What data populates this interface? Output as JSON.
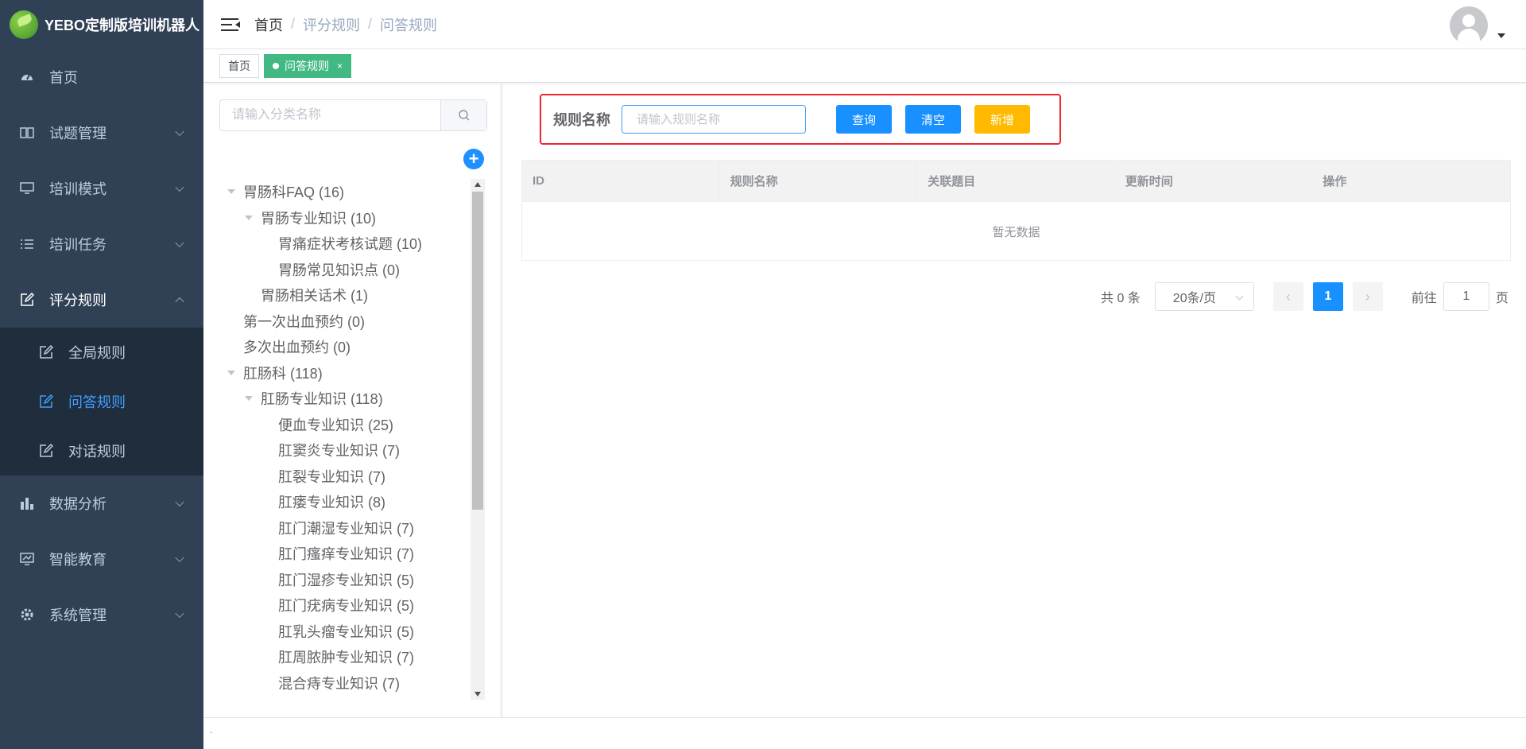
{
  "brand": {
    "title": "YEBO定制版培训机器人"
  },
  "sidebar": {
    "items": [
      {
        "label": "首页",
        "icon": "dashboard-icon",
        "has_children": false
      },
      {
        "label": "试题管理",
        "icon": "book-icon",
        "has_children": true
      },
      {
        "label": "培训模式",
        "icon": "monitor-icon",
        "has_children": true
      },
      {
        "label": "培训任务",
        "icon": "list-icon",
        "has_children": true
      },
      {
        "label": "评分规则",
        "icon": "edit-icon",
        "has_children": true,
        "open": true,
        "children": [
          {
            "label": "全局规则",
            "icon": "edit-icon",
            "active": false
          },
          {
            "label": "问答规则",
            "icon": "edit-icon",
            "active": true
          },
          {
            "label": "对话规则",
            "icon": "edit-icon",
            "active": false
          }
        ]
      },
      {
        "label": "数据分析",
        "icon": "chart-icon",
        "has_children": true
      },
      {
        "label": "智能教育",
        "icon": "education-icon",
        "has_children": true
      },
      {
        "label": "系统管理",
        "icon": "gear-icon",
        "has_children": true
      }
    ]
  },
  "header": {
    "breadcrumb": [
      "首页",
      "评分规则",
      "问答规则"
    ],
    "separator": "/"
  },
  "tags": [
    {
      "label": "首页",
      "active": false
    },
    {
      "label": "问答规则",
      "active": true,
      "close": "×"
    }
  ],
  "tree_panel": {
    "search_placeholder": "请输入分类名称",
    "add_symbol": "+",
    "nodes": [
      {
        "label": "胃肠科FAQ (16)",
        "level": 0,
        "expanded": true
      },
      {
        "label": "胃肠专业知识 (10)",
        "level": 1,
        "expanded": true
      },
      {
        "label": "胃痛症状考核试题 (10)",
        "level": 2
      },
      {
        "label": "胃肠常见知识点 (0)",
        "level": 2
      },
      {
        "label": "胃肠相关话术 (1)",
        "level": 1
      },
      {
        "label": "第一次出血预约 (0)",
        "level": 0
      },
      {
        "label": "多次出血预约 (0)",
        "level": 0
      },
      {
        "label": "肛肠科 (118)",
        "level": 0,
        "expanded": true
      },
      {
        "label": "肛肠专业知识 (118)",
        "level": 1,
        "expanded": true
      },
      {
        "label": "便血专业知识 (25)",
        "level": 2
      },
      {
        "label": "肛窦炎专业知识 (7)",
        "level": 2
      },
      {
        "label": "肛裂专业知识 (7)",
        "level": 2
      },
      {
        "label": "肛瘘专业知识 (8)",
        "level": 2
      },
      {
        "label": "肛门潮湿专业知识 (7)",
        "level": 2
      },
      {
        "label": "肛门瘙痒专业知识 (7)",
        "level": 2
      },
      {
        "label": "肛门湿疹专业知识 (5)",
        "level": 2
      },
      {
        "label": "肛门疣病专业知识 (5)",
        "level": 2
      },
      {
        "label": "肛乳头瘤专业知识 (5)",
        "level": 2
      },
      {
        "label": "肛周脓肿专业知识 (7)",
        "level": 2
      },
      {
        "label": "混合痔专业知识 (7)",
        "level": 2
      }
    ]
  },
  "filter": {
    "label": "规则名称",
    "placeholder": "请输入规则名称",
    "value": "",
    "query_button": "查询",
    "clear_button": "清空",
    "add_button": "新增"
  },
  "table": {
    "columns": [
      "ID",
      "规则名称",
      "关联题目",
      "更新时间",
      "操作"
    ],
    "rows": [],
    "empty_text": "暂无数据"
  },
  "pagination": {
    "total_text": "共 0 条",
    "page_size": "20条/页",
    "prev": "‹",
    "next": "›",
    "current_page": "1",
    "goto_label": "前往",
    "goto_value": "1",
    "page_label": "页"
  },
  "footer": {
    "text": "."
  },
  "colors": {
    "sidebar_bg": "#304156",
    "submenu_bg": "#1f2d3d",
    "active_menu": "#409eff",
    "tag_active": "#42b983",
    "primary_button": "#1890ff",
    "warning_button": "#ffba00",
    "highlight_border": "#f0262a"
  }
}
